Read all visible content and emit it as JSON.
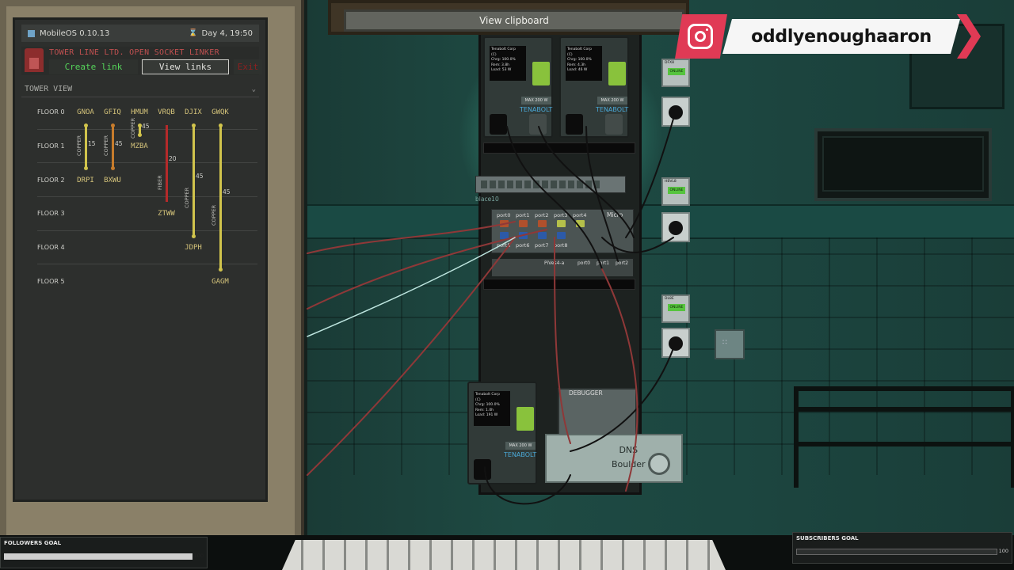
{
  "os": {
    "name": "MobileOS 0.10.13",
    "clock": "Day 4, 19:50"
  },
  "app": {
    "title": "TOWER LINE LTD. OPEN SOCKET LINKER",
    "create_label": "Create link",
    "view_label": "View links",
    "exit_label": "Exit",
    "view_name": "TOWER VIEW"
  },
  "tower": {
    "floors": [
      "FLOOR 0",
      "FLOOR 1",
      "FLOOR 2",
      "FLOOR 3",
      "FLOOR 4",
      "FLOOR 5"
    ],
    "nodes": {
      "gnoa": "GNOA",
      "gfiq": "GFIQ",
      "hmum": "HMUM",
      "vrqb": "VRQB",
      "djix": "DJIX",
      "gwqk": "GWQK",
      "mzba": "MZBA",
      "drpi": "DRPI",
      "bxwu": "BXWU",
      "ztww": "ZTWW",
      "jdph": "JDPH",
      "gagm": "GAGM"
    },
    "links": {
      "copper": "COPPER",
      "fiber": "FIBER",
      "l1": "15",
      "l2": "45",
      "l3": "45",
      "l4": "20",
      "l5": "45",
      "l6": "45"
    }
  },
  "scene": {
    "clipboard_label": "View clipboard",
    "ups": {
      "brand": "TENABOLT",
      "max": "MAX 200 W",
      "a": {
        "maker": "Tenabolt Corp",
        "model": "(C)",
        "chrg": "Chrg: 100.0%",
        "rem": "Rem: 3.8h",
        "load": "Load: 53 W"
      },
      "b": {
        "maker": "Tenabolt Corp",
        "model": "(C)",
        "chrg": "Chrg: 100.0%",
        "rem": "Rem: 4.3h",
        "load": "Load: 46 W"
      },
      "c": {
        "maker": "Tenabolt Corp",
        "model": "(C)",
        "chrg": "Chrg: 100.0%",
        "rem": "Rem: 1.0h",
        "load": "Load: 191 W"
      }
    },
    "switch_name": "blace10",
    "router_ports": [
      "port0",
      "port1",
      "port2",
      "port3",
      "port4",
      "port5",
      "port6",
      "port7",
      "port8"
    ],
    "router_brand": "Micro",
    "modem_labels": {
      "model": "PiVes4-a",
      "p0": "port0",
      "p1": "port1",
      "p2": "port2"
    },
    "debugger_label": "DEBUGGER",
    "dns_label": "DNS\nBoulder",
    "breakers": [
      {
        "label": "DFX8",
        "state": "ONLINE"
      },
      {
        "label": "HBVL8",
        "state": "ONLINE"
      },
      {
        "label": "DL8E",
        "state": "ONLINE"
      }
    ]
  },
  "overlay": {
    "instagram_handle": "oddlyenoughaaron",
    "followers_goal": "FOLLOWERS GOAL",
    "followers_value": "100",
    "subscribers_goal": "SUBSCRIBERS GOAL",
    "subscribers_value": "100"
  },
  "colors": {
    "copper_yellow": "#d1c44c",
    "copper_orange": "#c77c2c",
    "fiber_red": "#b52a2a",
    "instagram_pink": "#e03a55",
    "create_green": "#55d45a",
    "title_red": "#c05050"
  }
}
